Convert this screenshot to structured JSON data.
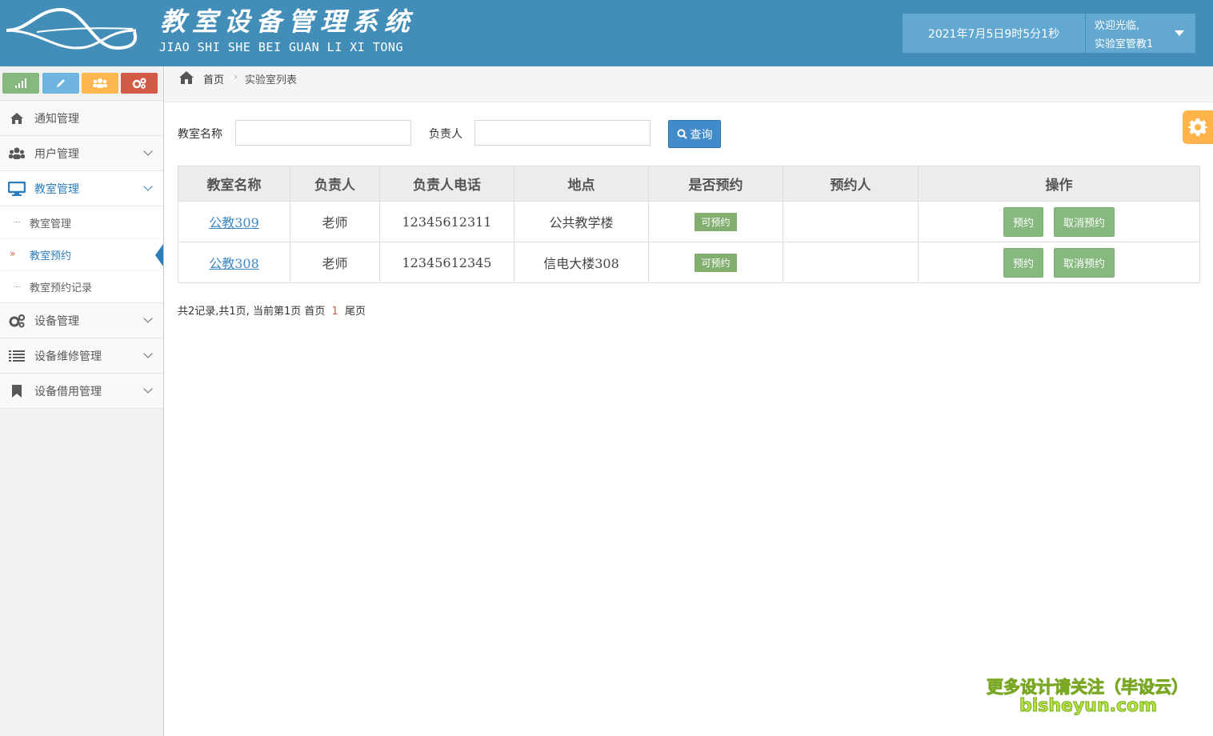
{
  "header": {
    "title": "教室设备管理系统",
    "subtitle": "JIAO SHI SHE BEI GUAN LI XI TONG",
    "datetime": "2021年7月5日9时5分1秒",
    "welcome": "欢迎光临,",
    "username": "实验室管教1",
    "brand_color": "#438eb9"
  },
  "shortcuts": [
    {
      "icon": "signal-icon",
      "color": "#87b87f"
    },
    {
      "icon": "pencil-icon",
      "color": "#6fb3e0"
    },
    {
      "icon": "users-icon",
      "color": "#ffb752"
    },
    {
      "icon": "cogs-icon",
      "color": "#d15b47"
    }
  ],
  "sidebar": {
    "items": [
      {
        "label": "通知管理",
        "icon": "home-icon"
      },
      {
        "label": "用户管理",
        "icon": "users-icon"
      },
      {
        "label": "教室管理",
        "icon": "desktop-icon",
        "open": true,
        "children": [
          {
            "label": "教室管理"
          },
          {
            "label": "教室预约",
            "active": true
          },
          {
            "label": "教室预约记录"
          }
        ]
      },
      {
        "label": "设备管理",
        "icon": "cogs-icon"
      },
      {
        "label": "设备维修管理",
        "icon": "list-icon"
      },
      {
        "label": "设备借用管理",
        "icon": "bookmark-icon"
      }
    ]
  },
  "breadcrumb": {
    "home": "首页",
    "current": "实验室列表"
  },
  "search": {
    "name_label": "教室名称",
    "name_value": "",
    "owner_label": "负责人",
    "owner_value": "",
    "button_label": "查询"
  },
  "table": {
    "columns": [
      "教室名称",
      "负责人",
      "负责人电话",
      "地点",
      "是否预约",
      "预约人",
      "操作"
    ],
    "rows": [
      {
        "name": "公教309",
        "owner": "老师",
        "phone": "12345612311",
        "location": "公共教学楼",
        "status": "可预约",
        "booker": "",
        "action1": "预约",
        "action2": "取消预约"
      },
      {
        "name": "公教308",
        "owner": "老师",
        "phone": "12345612345",
        "location": "信电大楼308",
        "status": "可预约",
        "booker": "",
        "action1": "预约",
        "action2": "取消预约"
      }
    ]
  },
  "pager": {
    "summary": "共2记录,共1页, 当前第1页",
    "first": "首页",
    "current": "1",
    "last": "尾页"
  },
  "watermark": {
    "line1": "更多设计请关注（毕设云）",
    "line2": "bisheyun.com"
  }
}
